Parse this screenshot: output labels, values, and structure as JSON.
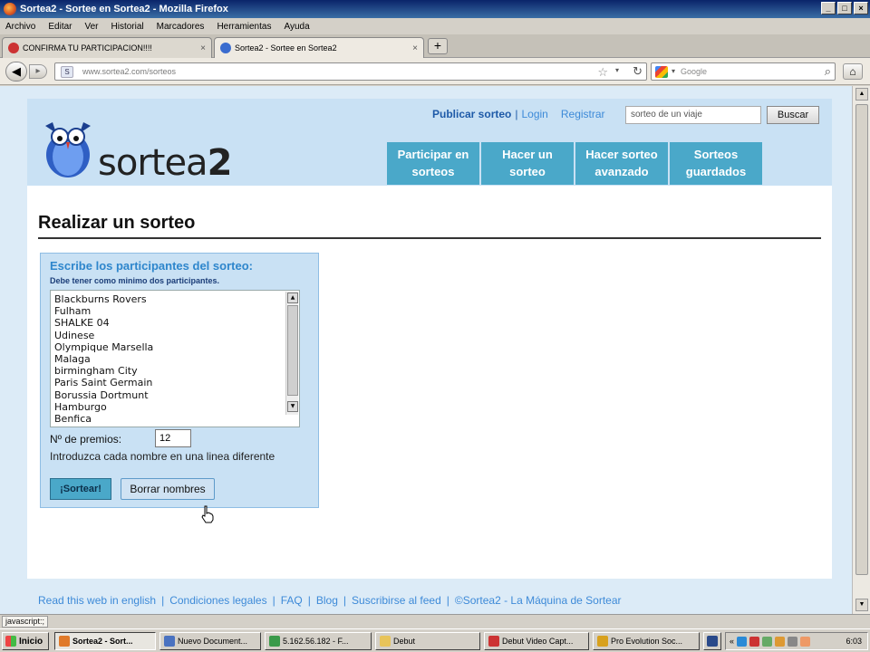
{
  "window": {
    "title": "Sortea2 - Sortee en Sortea2 - Mozilla Firefox"
  },
  "menu": [
    "Archivo",
    "Editar",
    "Ver",
    "Historial",
    "Marcadores",
    "Herramientas",
    "Ayuda"
  ],
  "tabs": [
    {
      "label": "CONFIRMA TU PARTICIPACION!!!!"
    },
    {
      "label": "Sortea2 - Sortee en Sortea2"
    }
  ],
  "navbar": {
    "url": "www.sortea2.com/sorteos",
    "search_placeholder": "Google"
  },
  "site": {
    "logo_text_a": "sortea",
    "logo_text_b": "2",
    "top_links": {
      "publicar": "Publicar sorteo",
      "sep": "|",
      "login": "Login",
      "registrar": "Registrar"
    },
    "search_value": "sorteo de un viaje",
    "search_button": "Buscar",
    "nav": [
      "Participar en sorteos",
      "Hacer un sorteo",
      "Hacer sorteo avanzado",
      "Sorteos guardados"
    ]
  },
  "main": {
    "heading": "Realizar un sorteo",
    "box_title": "Escribe los participantes del sorteo:",
    "box_sub": "Debe tener como minimo dos participantes.",
    "participants": [
      "Blackburns Rovers",
      "Fulham",
      "SHALKE 04",
      "Udinese",
      "Olympique Marsella",
      "Malaga",
      "birmingham City",
      "Paris Saint Germain",
      "Borussia Dortmunt",
      "Hamburgo",
      "Benfica"
    ],
    "premios_label": "Nº de premios:",
    "premios_value": "12",
    "instructions": "Introduzca cada nombre en una linea diferente",
    "btn_sortear": "¡Sortear!",
    "btn_borrar": "Borrar nombres"
  },
  "footer": [
    "Read this web in english",
    "Condiciones legales",
    "FAQ",
    "Blog",
    "Suscribirse al feed",
    "©Sortea2 - La Máquina de Sortear"
  ],
  "footer_sep": "|",
  "status": "javascript:;",
  "taskbar": {
    "start": "Inicio",
    "tasks": [
      "Sortea2 - Sort...",
      "Nuevo Document...",
      "5.162.56.182 - F...",
      "Debut",
      "Debut Video Capt...",
      "Pro Evolution Soc..."
    ],
    "clock": "6:03"
  }
}
